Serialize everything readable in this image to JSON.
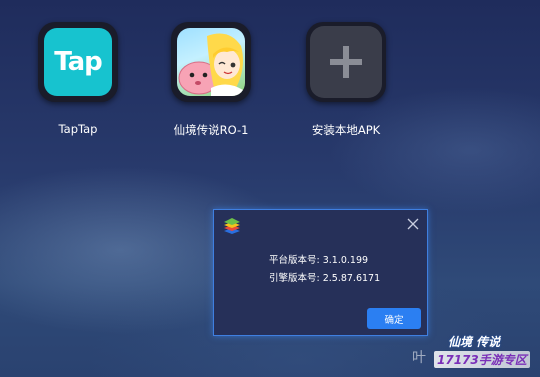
{
  "apps": [
    {
      "label": "TapTap",
      "icon": "taptap-icon",
      "icon_text": "Tap"
    },
    {
      "label": "仙境传说RO-1",
      "icon": "ragnarok-game-icon"
    },
    {
      "label": "安装本地APK",
      "icon": "plus-icon"
    }
  ],
  "dialog": {
    "logo_icon": "bluestacks-logo-icon",
    "close_icon": "close-icon",
    "platform_version": "平台版本号: 3.1.0.199",
    "engine_version": "引擎版本号: 2.5.87.6171",
    "ok_label": "确定"
  },
  "watermark": {
    "prefix": "叶",
    "line1": "仙境 传说",
    "line2": "17173手游专区"
  },
  "colors": {
    "accent": "#2b7ff2",
    "taptap": "#17c3cf",
    "dialog_bg": "#263059"
  }
}
